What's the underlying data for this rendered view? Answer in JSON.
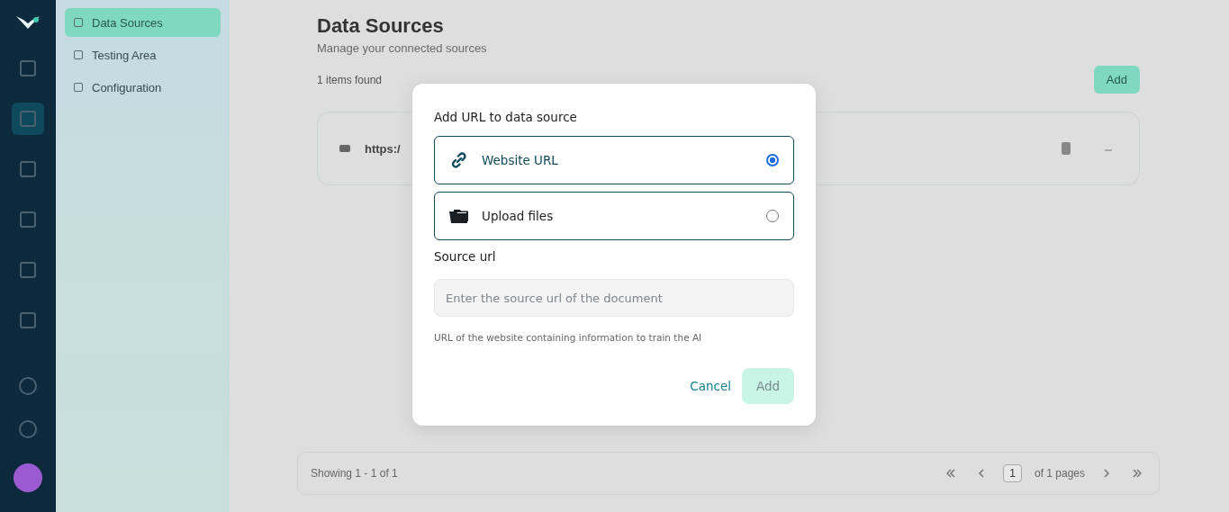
{
  "rail": {
    "items": [
      {
        "selected": false
      },
      {
        "selected": true
      },
      {
        "selected": false
      },
      {
        "selected": false
      },
      {
        "selected": false
      },
      {
        "selected": false
      }
    ]
  },
  "sidebar": {
    "items": [
      {
        "label": "Data Sources",
        "selected": true
      },
      {
        "label": "Testing Area",
        "selected": false
      },
      {
        "label": "Configuration",
        "selected": false
      }
    ]
  },
  "page": {
    "title": "Data Sources",
    "subtitle": "Manage your connected sources",
    "count": "1 items found",
    "add_button": "Add",
    "rows": [
      {
        "url": "https:/"
      }
    ],
    "pagination": {
      "showing": "Showing 1 - 1 of 1",
      "page": "1",
      "pages": "of 1 pages"
    }
  },
  "dialog": {
    "title": "Add URL to data source",
    "options": [
      {
        "kind": "link",
        "label": "Website URL",
        "selected": true
      },
      {
        "kind": "folder",
        "label": "Upload files",
        "selected": false
      }
    ],
    "field_label": "Source url",
    "placeholder": "Enter the source url of the document",
    "help": "URL of the website containing information to train the AI",
    "cancel": "Cancel",
    "submit": {
      "label": "Add",
      "disabled": true
    }
  }
}
